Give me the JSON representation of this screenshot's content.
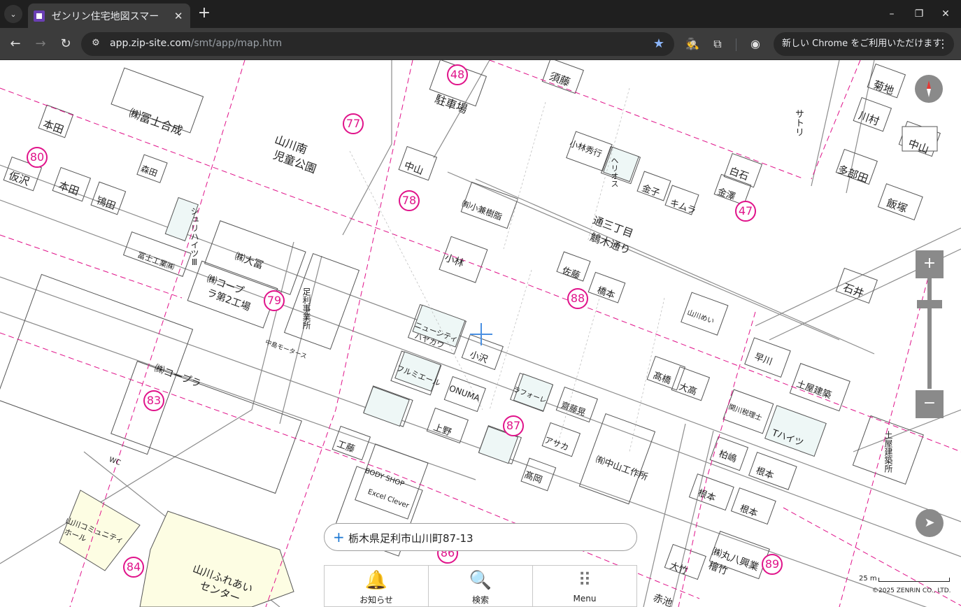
{
  "browser": {
    "tab": {
      "title": "ゼンリン住宅地図スマー",
      "favicon": "zenrin-favicon"
    },
    "url_host": "app.zip-site.com",
    "url_path": "/smt/app/map.htm",
    "update_button": "新しい Chrome をご利用いただけます",
    "icons": {
      "tab_list": "chevron-down-icon",
      "close_tab": "close-icon",
      "new_tab": "plus-icon",
      "minimize": "minimize-icon",
      "restore": "restore-icon",
      "close_window": "close-icon",
      "back": "back-arrow-icon",
      "forward": "forward-arrow-icon",
      "reload": "reload-icon",
      "site_info": "tune-icon",
      "bookmark": "star-icon",
      "extension_1": "spy-icon",
      "extensions": "puzzle-icon",
      "profile": "profile-icon",
      "menu": "kebab-icon"
    },
    "glyphs": {
      "tab_list": "⌄",
      "close": "✕",
      "new_tab": "+",
      "minimize": "–",
      "restore": "❐",
      "back": "←",
      "forward": "→",
      "reload": "↻",
      "site_info": "⚙",
      "star": "★",
      "spy": "🕵",
      "puzzle": "⧉",
      "profile": "◉",
      "kebab": "⋮"
    }
  },
  "map": {
    "labels": [
      {
        "text": "㈱冨士合成",
        "cls": ""
      },
      {
        "text": "山川南",
        "cls": ""
      },
      {
        "text": "児童公園",
        "cls": ""
      },
      {
        "text": "駐車場",
        "cls": ""
      },
      {
        "text": "須藤",
        "cls": ""
      },
      {
        "text": "菊地",
        "cls": ""
      },
      {
        "text": "川村",
        "cls": ""
      },
      {
        "text": "中山",
        "cls": ""
      },
      {
        "text": "多部田",
        "cls": ""
      },
      {
        "text": "飯塚",
        "cls": ""
      },
      {
        "text": "石井",
        "cls": ""
      },
      {
        "text": "本田",
        "cls": ""
      },
      {
        "text": "仮沢",
        "cls": ""
      },
      {
        "text": "本田",
        "cls": ""
      },
      {
        "text": "鴇田",
        "cls": ""
      },
      {
        "text": "森田",
        "cls": ""
      },
      {
        "text": "中山",
        "cls": ""
      },
      {
        "text": "㈲小兼樹脂",
        "cls": ""
      },
      {
        "text": "小林",
        "cls": ""
      },
      {
        "text": "小林秀行",
        "cls": ""
      },
      {
        "text": "ヘリオス",
        "cls": ""
      },
      {
        "text": "金子",
        "cls": ""
      },
      {
        "text": "キムラ",
        "cls": ""
      },
      {
        "text": "白石",
        "cls": ""
      },
      {
        "text": "金澤",
        "cls": ""
      },
      {
        "text": "通三丁目",
        "cls": ""
      },
      {
        "text": "鵤木通り",
        "cls": ""
      },
      {
        "text": "佐藤",
        "cls": ""
      },
      {
        "text": "橋本",
        "cls": ""
      },
      {
        "text": "冨士工業㈱",
        "cls": ""
      },
      {
        "text": "㈱大冨",
        "cls": ""
      },
      {
        "text": "㈱コープ",
        "cls": ""
      },
      {
        "text": "ラ第2工場",
        "cls": ""
      },
      {
        "text": "足利事業所",
        "cls": ""
      },
      {
        "text": "ニューシティ",
        "cls": ""
      },
      {
        "text": "ハヤカワ",
        "cls": ""
      },
      {
        "text": "小沢",
        "cls": ""
      },
      {
        "text": "フルミエール",
        "cls": ""
      },
      {
        "text": "ONUMA",
        "cls": ""
      },
      {
        "text": "ラフォーレ",
        "cls": ""
      },
      {
        "text": "上野",
        "cls": ""
      },
      {
        "text": "齋藤晃",
        "cls": ""
      },
      {
        "text": "アサカ",
        "cls": ""
      },
      {
        "text": "髙岡",
        "cls": ""
      },
      {
        "text": "㈲中山工作所",
        "cls": ""
      },
      {
        "text": "工藤",
        "cls": ""
      },
      {
        "text": "BODY SHOP",
        "cls": ""
      },
      {
        "text": "Excel Clever",
        "cls": ""
      },
      {
        "text": "㈱コープラ",
        "cls": ""
      },
      {
        "text": "山川コミュニティ",
        "cls": ""
      },
      {
        "text": "ホール",
        "cls": ""
      },
      {
        "text": "山川ふれあい",
        "cls": ""
      },
      {
        "text": "センター",
        "cls": ""
      },
      {
        "text": "山川めい",
        "cls": ""
      },
      {
        "text": "髙橋",
        "cls": ""
      },
      {
        "text": "大高",
        "cls": ""
      },
      {
        "text": "早川",
        "cls": ""
      },
      {
        "text": "土屋建築",
        "cls": ""
      },
      {
        "text": "関川税理士",
        "cls": ""
      },
      {
        "text": "Tハイツ",
        "cls": ""
      },
      {
        "text": "柏嶋",
        "cls": ""
      },
      {
        "text": "根本",
        "cls": ""
      },
      {
        "text": "根本",
        "cls": ""
      },
      {
        "text": "根本",
        "cls": ""
      },
      {
        "text": "大竹",
        "cls": ""
      },
      {
        "text": "㈱丸八興業",
        "cls": ""
      },
      {
        "text": "檜竹",
        "cls": ""
      },
      {
        "text": "赤池",
        "cls": ""
      },
      {
        "text": "土屋建築所",
        "cls": ""
      },
      {
        "text": "サトリ",
        "cls": ""
      },
      {
        "text": "シュリハイツⅢ",
        "cls": ""
      },
      {
        "text": "中島モータース",
        "cls": ""
      },
      {
        "text": "WC",
        "cls": ""
      }
    ],
    "pins": [
      "48",
      "77",
      "78",
      "80",
      "47",
      "88",
      "79",
      "87",
      "83",
      "84",
      "89",
      "86"
    ],
    "compass_icon": "compass-icon",
    "zoom_in": "+",
    "zoom_out": "−",
    "locate_glyph": "➤",
    "crosshair_icon": "crosshair-icon"
  },
  "address": {
    "plus": "+",
    "text": "栃木県足利市山川町87-13"
  },
  "bottom_nav": [
    {
      "label": "お知らせ",
      "icon": "bell-icon",
      "glyph": "🔔"
    },
    {
      "label": "検索",
      "icon": "search-icon",
      "glyph": "🔍"
    },
    {
      "label": "Menu",
      "icon": "grid-icon",
      "glyph": "⠿"
    }
  ],
  "scale": "25 m",
  "copyright": "©2025 ZENRIN CO., LTD.",
  "colors": {
    "pin": "#e0138a",
    "boundary": "#e0138a",
    "road_line": "#9e9e9e",
    "control": "#8a8a8a",
    "accent": "#1976d2"
  }
}
